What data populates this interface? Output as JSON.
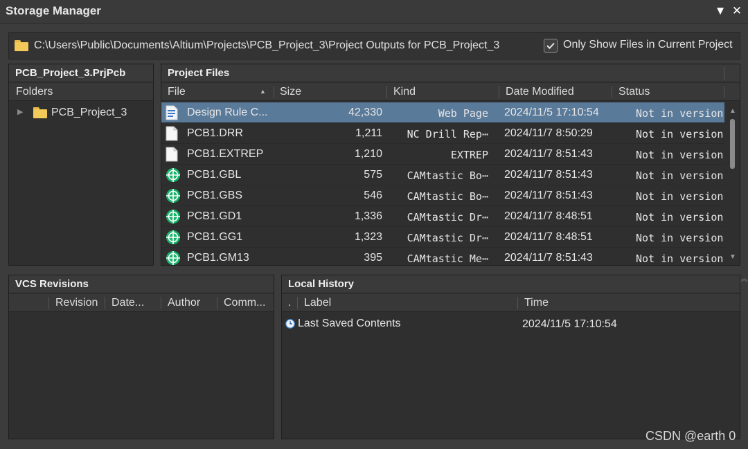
{
  "window": {
    "title": "Storage Manager",
    "menu_icon": "triangle-down-icon",
    "close_icon": "close-icon"
  },
  "pathbar": {
    "path": "C:\\Users\\Public\\Documents\\Altium\\Projects\\PCB_Project_3\\Project Outputs for PCB_Project_3",
    "only_current_label": "Only Show Files in Current Project",
    "only_current_checked": true
  },
  "project_panel": {
    "title": "PCB_Project_3.PrjPcb",
    "folders_header": "Folders",
    "tree_item": "PCB_Project_3"
  },
  "files_panel": {
    "title": "Project Files",
    "columns": [
      "File",
      "Size",
      "Kind",
      "Date Modified",
      "Status"
    ],
    "rows": [
      {
        "name": "Design Rule C...",
        "size": "42,330",
        "kind": "Web Page",
        "date": "2024/11/5 17:10:54",
        "status": "Not in version",
        "icon": "web-page-icon",
        "selected": true
      },
      {
        "name": "PCB1.DRR",
        "size": "1,211",
        "kind": "NC Drill Rep⋯",
        "date": "2024/11/7 8:50:29",
        "status": "Not in version",
        "icon": "document-icon"
      },
      {
        "name": "PCB1.EXTREP",
        "size": "1,210",
        "kind": "EXTREP",
        "date": "2024/11/7 8:51:43",
        "status": "Not in version",
        "icon": "document-icon"
      },
      {
        "name": "PCB1.GBL",
        "size": "575",
        "kind": "CAMtastic Bo⋯",
        "date": "2024/11/7 8:51:43",
        "status": "Not in version",
        "icon": "camtastic-icon"
      },
      {
        "name": "PCB1.GBS",
        "size": "546",
        "kind": "CAMtastic Bo⋯",
        "date": "2024/11/7 8:51:43",
        "status": "Not in version",
        "icon": "camtastic-icon"
      },
      {
        "name": "PCB1.GD1",
        "size": "1,336",
        "kind": "CAMtastic Dr⋯",
        "date": "2024/11/7 8:48:51",
        "status": "Not in version",
        "icon": "camtastic-icon"
      },
      {
        "name": "PCB1.GG1",
        "size": "1,323",
        "kind": "CAMtastic Dr⋯",
        "date": "2024/11/7 8:48:51",
        "status": "Not in version",
        "icon": "camtastic-icon"
      },
      {
        "name": "PCB1.GM13",
        "size": "395",
        "kind": "CAMtastic Me⋯",
        "date": "2024/11/7 8:51:43",
        "status": "Not in version",
        "icon": "camtastic-icon"
      }
    ]
  },
  "vcs_panel": {
    "title": "VCS Revisions",
    "columns": [
      "Revision",
      "Date...",
      "Author",
      "Comm..."
    ]
  },
  "history_panel": {
    "title": "Local History",
    "columns": [
      ".",
      "Label",
      "Time"
    ],
    "rows": [
      {
        "label": "Last Saved Contents",
        "time": "2024/11/5 17:10:54",
        "icon": "clock-icon"
      }
    ]
  },
  "watermark": "CSDN @earth 0",
  "colors": {
    "selection": "#5a7a9a",
    "background": "#3c3c3c",
    "camtastic_icon": "#19b36b"
  }
}
